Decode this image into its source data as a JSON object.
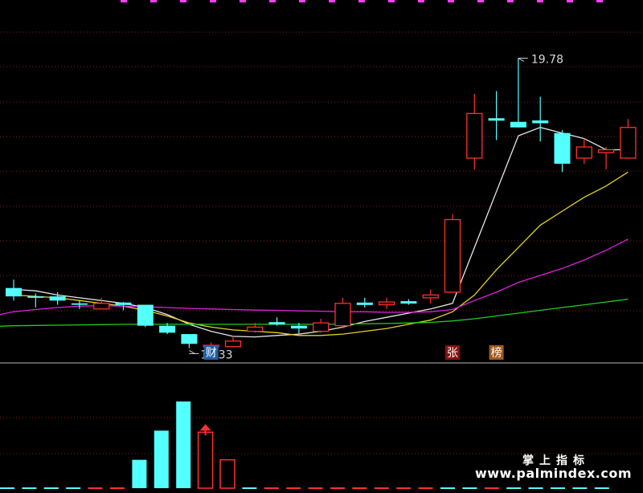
{
  "chart_data": {
    "type": "candlestick",
    "main_panel": {
      "price_range": [
        9.5,
        21.0
      ],
      "candles": [
        {
          "o": 11.55,
          "c": 11.25,
          "h": 11.85,
          "l": 11.1
        },
        {
          "o": 11.25,
          "c": 11.2,
          "h": 11.35,
          "l": 10.85
        },
        {
          "o": 11.25,
          "c": 11.1,
          "h": 11.4,
          "l": 10.95
        },
        {
          "o": 11.0,
          "c": 10.95,
          "h": 11.1,
          "l": 10.8
        },
        {
          "o": 10.8,
          "c": 11.0,
          "h": 11.2,
          "l": 10.8
        },
        {
          "o": 11.0,
          "c": 11.0,
          "h": 11.05,
          "l": 10.75
        },
        {
          "o": 10.95,
          "c": 10.2,
          "h": 10.95,
          "l": 10.15
        },
        {
          "o": 10.2,
          "c": 9.95,
          "h": 10.3,
          "l": 9.9
        },
        {
          "o": 9.9,
          "c": 9.55,
          "h": 9.9,
          "l": 9.4
        },
        {
          "o": 9.45,
          "c": 9.5,
          "h": 9.6,
          "l": 9.45
        },
        {
          "o": 9.45,
          "c": 9.65,
          "h": 9.85,
          "l": 9.45
        },
        {
          "o": 10.0,
          "c": 10.15,
          "h": 10.3,
          "l": 9.95
        },
        {
          "o": 10.3,
          "c": 10.3,
          "h": 10.5,
          "l": 10.2
        },
        {
          "o": 10.2,
          "c": 10.1,
          "h": 10.3,
          "l": 9.9
        },
        {
          "o": 10.0,
          "c": 10.3,
          "h": 10.45,
          "l": 9.95
        },
        {
          "o": 10.2,
          "c": 11.0,
          "h": 11.2,
          "l": 10.1
        },
        {
          "o": 11.0,
          "c": 11.0,
          "h": 11.2,
          "l": 10.85
        },
        {
          "o": 10.95,
          "c": 11.05,
          "h": 11.2,
          "l": 10.8
        },
        {
          "o": 11.05,
          "c": 11.05,
          "h": 11.15,
          "l": 10.95
        },
        {
          "o": 11.2,
          "c": 11.3,
          "h": 11.5,
          "l": 11.0
        },
        {
          "o": 11.4,
          "c": 14.0,
          "h": 14.2,
          "l": 11.4
        },
        {
          "o": 16.2,
          "c": 17.8,
          "h": 18.5,
          "l": 15.8
        },
        {
          "o": 17.6,
          "c": 17.6,
          "h": 18.6,
          "l": 16.85
        },
        {
          "o": 17.5,
          "c": 17.3,
          "h": 19.78,
          "l": 17.3
        },
        {
          "o": 17.55,
          "c": 17.45,
          "h": 18.4,
          "l": 16.8
        },
        {
          "o": 17.1,
          "c": 16.0,
          "h": 17.2,
          "l": 15.7
        },
        {
          "o": 16.2,
          "c": 16.6,
          "h": 16.9,
          "l": 16.0
        },
        {
          "o": 16.4,
          "c": 16.5,
          "h": 16.6,
          "l": 15.8
        },
        {
          "o": 16.2,
          "c": 17.3,
          "h": 17.6,
          "l": 16.2
        }
      ],
      "moving_averages": [
        {
          "name": "MA5",
          "color": "#e6e6e6",
          "values": [
            11.5,
            11.45,
            11.3,
            11.2,
            11.1,
            11.0,
            10.85,
            10.6,
            10.25,
            10.0,
            9.82,
            9.8,
            9.85,
            9.9,
            10.0,
            10.15,
            10.35,
            10.5,
            10.65,
            10.8,
            11.0,
            13.0,
            15.0,
            17.0,
            17.3,
            17.1,
            16.9,
            16.5,
            16.5
          ]
        },
        {
          "name": "MA10",
          "color": "#e6d21e",
          "values": [
            11.3,
            11.25,
            11.2,
            11.1,
            11.0,
            10.9,
            10.75,
            10.55,
            10.3,
            10.15,
            10.05,
            10.0,
            9.95,
            9.85,
            9.85,
            9.9,
            10.0,
            10.1,
            10.25,
            10.4,
            10.7,
            11.3,
            12.2,
            13.0,
            13.8,
            14.3,
            14.8,
            15.2,
            15.7
          ]
        },
        {
          "name": "MA20",
          "color": "#dd22dd",
          "values": [
            10.7,
            10.78,
            10.85,
            10.9,
            10.92,
            10.9,
            10.88,
            10.85,
            10.82,
            10.8,
            10.78,
            10.76,
            10.75,
            10.73,
            10.72,
            10.7,
            10.7,
            10.68,
            10.68,
            10.7,
            10.78,
            11.1,
            11.4,
            11.75,
            12.0,
            12.25,
            12.55,
            12.9,
            13.3
          ]
        },
        {
          "name": "MA60",
          "color": "#22cc22",
          "values": [
            10.2,
            10.21,
            10.22,
            10.23,
            10.24,
            10.25,
            10.25,
            10.25,
            10.25,
            10.25,
            10.25,
            10.25,
            10.25,
            10.25,
            10.25,
            10.26,
            10.27,
            10.28,
            10.3,
            10.32,
            10.37,
            10.45,
            10.55,
            10.65,
            10.75,
            10.85,
            10.95,
            11.05,
            11.15
          ]
        }
      ],
      "annotations": [
        {
          "text": "19.78",
          "candle": 23,
          "type": "high"
        },
        {
          "text": "10.33",
          "candle": 8,
          "type": "low"
        }
      ],
      "markers": [
        {
          "text": "财",
          "candle": 9,
          "bg": "#1f5fa8",
          "color": "#ffffff"
        },
        {
          "text": "张",
          "candle": 20,
          "bg": "#8b1010",
          "color": "#ffffff"
        },
        {
          "text": "榜",
          "candle": 22,
          "bg": "#a05a1e",
          "color": "#ffffff"
        }
      ]
    },
    "sub_panel": {
      "range": [
        0,
        110
      ],
      "bars": [
        {
          "v": 0,
          "color": "cyan"
        },
        {
          "v": 0,
          "color": "cyan"
        },
        {
          "v": 0,
          "color": "cyan"
        },
        {
          "v": 0,
          "color": "cyan"
        },
        {
          "v": 0,
          "color": "red"
        },
        {
          "v": 0,
          "color": "red"
        },
        {
          "v": 36,
          "color": "cyan"
        },
        {
          "v": 73,
          "color": "cyan"
        },
        {
          "v": 110,
          "color": "cyan"
        },
        {
          "v": 71,
          "color": "red"
        },
        {
          "v": 36,
          "color": "red"
        },
        {
          "v": 0,
          "color": "cyan"
        },
        {
          "v": 0,
          "color": "red"
        },
        {
          "v": 0,
          "color": "red"
        },
        {
          "v": 0,
          "color": "red"
        },
        {
          "v": 0,
          "color": "red"
        },
        {
          "v": 0,
          "color": "red"
        },
        {
          "v": 0,
          "color": "red"
        },
        {
          "v": 0,
          "color": "red"
        },
        {
          "v": 0,
          "color": "red"
        },
        {
          "v": 0,
          "color": "cyan"
        },
        {
          "v": 0,
          "color": "cyan"
        },
        {
          "v": 0,
          "color": "red"
        },
        {
          "v": 0,
          "color": "cyan"
        },
        {
          "v": 0,
          "color": "cyan"
        },
        {
          "v": 0,
          "color": "cyan"
        },
        {
          "v": 0,
          "color": "cyan"
        },
        {
          "v": 0,
          "color": "cyan"
        }
      ],
      "arrow_bar": 9
    },
    "colors": {
      "up": "#ff3030",
      "down": "#54ffff",
      "grid": "#8a1a1a",
      "separator": "#b8b8b8",
      "top_dash": "#ff40ff"
    }
  },
  "watermark": {
    "line1": "掌上指标",
    "line2": "www.palmindex.com"
  }
}
